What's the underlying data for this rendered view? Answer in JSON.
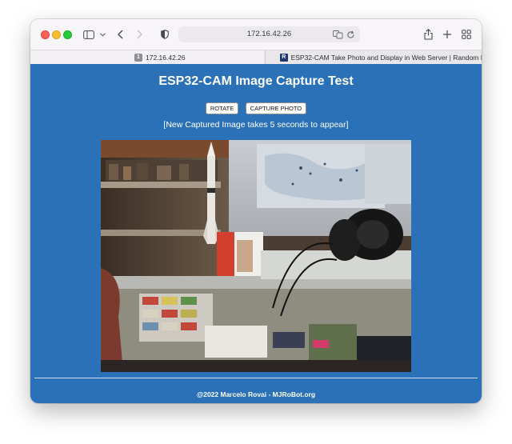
{
  "browser": {
    "address": "172.16.42.26",
    "tabs": [
      {
        "label": "172.16.42.26",
        "favicon": "1"
      },
      {
        "label": "ESP32-CAM Take Photo and Display in Web Server | Random N...",
        "favicon": "R"
      }
    ]
  },
  "page": {
    "title": "ESP32-CAM Image Capture Test",
    "buttons": {
      "rotate": "ROTATE",
      "capture": "CAPTURE PHOTO"
    },
    "note": "[New Captured Image takes 5 seconds to appear]",
    "footer": "@2022 Marcelo Rovai - MJRoBot.org"
  },
  "colors": {
    "page_bg": "#2a71b8",
    "text": "#ffffff"
  }
}
